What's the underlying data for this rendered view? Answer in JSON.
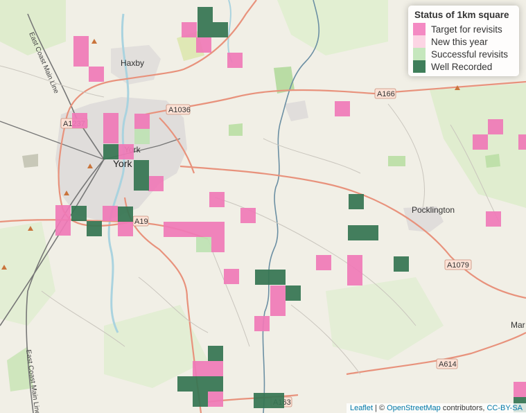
{
  "legend": {
    "title": "Status of 1km square",
    "items": [
      {
        "label": "Target for revisits",
        "color": "#f48ac3"
      },
      {
        "label": "New this year",
        "color": "#fcd5e4"
      },
      {
        "label": "Successful revisits",
        "color": "#c5e7bd"
      },
      {
        "label": "Well Recorded",
        "color": "#3f7e5a"
      }
    ]
  },
  "places": {
    "haxby": "Haxby",
    "york": "York",
    "york_small": "York",
    "pocklington": "Pocklington",
    "mar": "Mar"
  },
  "roads": {
    "a1237": "A1237",
    "a1036": "A1036",
    "a166": "A166",
    "a19": "A19",
    "a1079": "A1079",
    "a614": "A614",
    "a163": "A163"
  },
  "railway": {
    "ecml_north": "East Coast Main Line",
    "ecml_south": "East Coast Main Line"
  },
  "attribution": {
    "leaflet": "Leaflet",
    "sep": " | © ",
    "osm": "OpenStreetMap",
    "contrib": " contributors, ",
    "license": "CC-BY-SA"
  }
}
